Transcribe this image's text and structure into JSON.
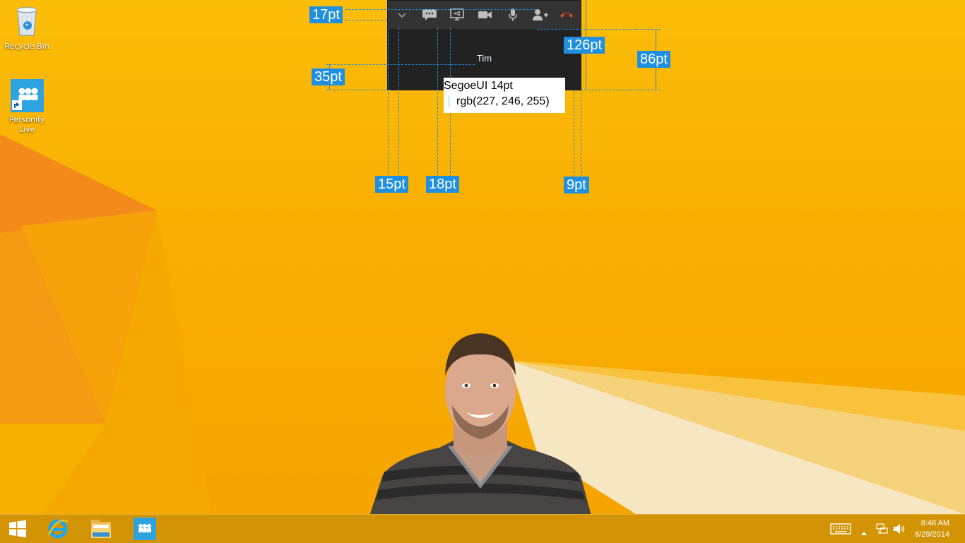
{
  "desktop": {
    "icons": [
      {
        "label": "Recycle Bin",
        "icon": "recycle-bin-icon"
      },
      {
        "label": "Personify Live",
        "icon": "personify-live-icon"
      }
    ]
  },
  "call_window": {
    "toolbar": {
      "buttons": [
        {
          "name": "collapse",
          "icon": "chevron-down-icon"
        },
        {
          "name": "chat",
          "icon": "chat-icon"
        },
        {
          "name": "share-screen",
          "icon": "share-screen-icon"
        },
        {
          "name": "video",
          "icon": "video-camera-icon"
        },
        {
          "name": "microphone",
          "icon": "microphone-icon"
        },
        {
          "name": "add-person",
          "icon": "add-person-icon"
        },
        {
          "name": "hang-up",
          "icon": "hang-up-icon",
          "color": "#e0492b"
        }
      ]
    },
    "caller_name": "Tim",
    "caller_name_color": "#e3f6ff"
  },
  "annotations": {
    "labels": {
      "toolbar_height": "17pt",
      "window_height": "126pt",
      "video_height": "86pt",
      "name_offset": "35pt",
      "left_padding": "15pt",
      "text_offset": "18pt",
      "right_padding": "9pt"
    },
    "spec": {
      "font": "SegoeUI 14pt",
      "color": "rgb(227, 246, 255)"
    }
  },
  "taskbar": {
    "apps": [
      {
        "name": "start",
        "icon": "windows-logo-icon"
      },
      {
        "name": "internet-explorer",
        "icon": "internet-explorer-icon"
      },
      {
        "name": "file-explorer",
        "icon": "file-explorer-icon"
      },
      {
        "name": "personify-live",
        "icon": "personify-live-icon"
      }
    ],
    "tray": {
      "icons": [
        "keyboard-icon",
        "show-hidden-icons-icon",
        "network-icon",
        "volume-icon"
      ],
      "time": "8:48 AM",
      "date": "8/29/2014"
    }
  }
}
